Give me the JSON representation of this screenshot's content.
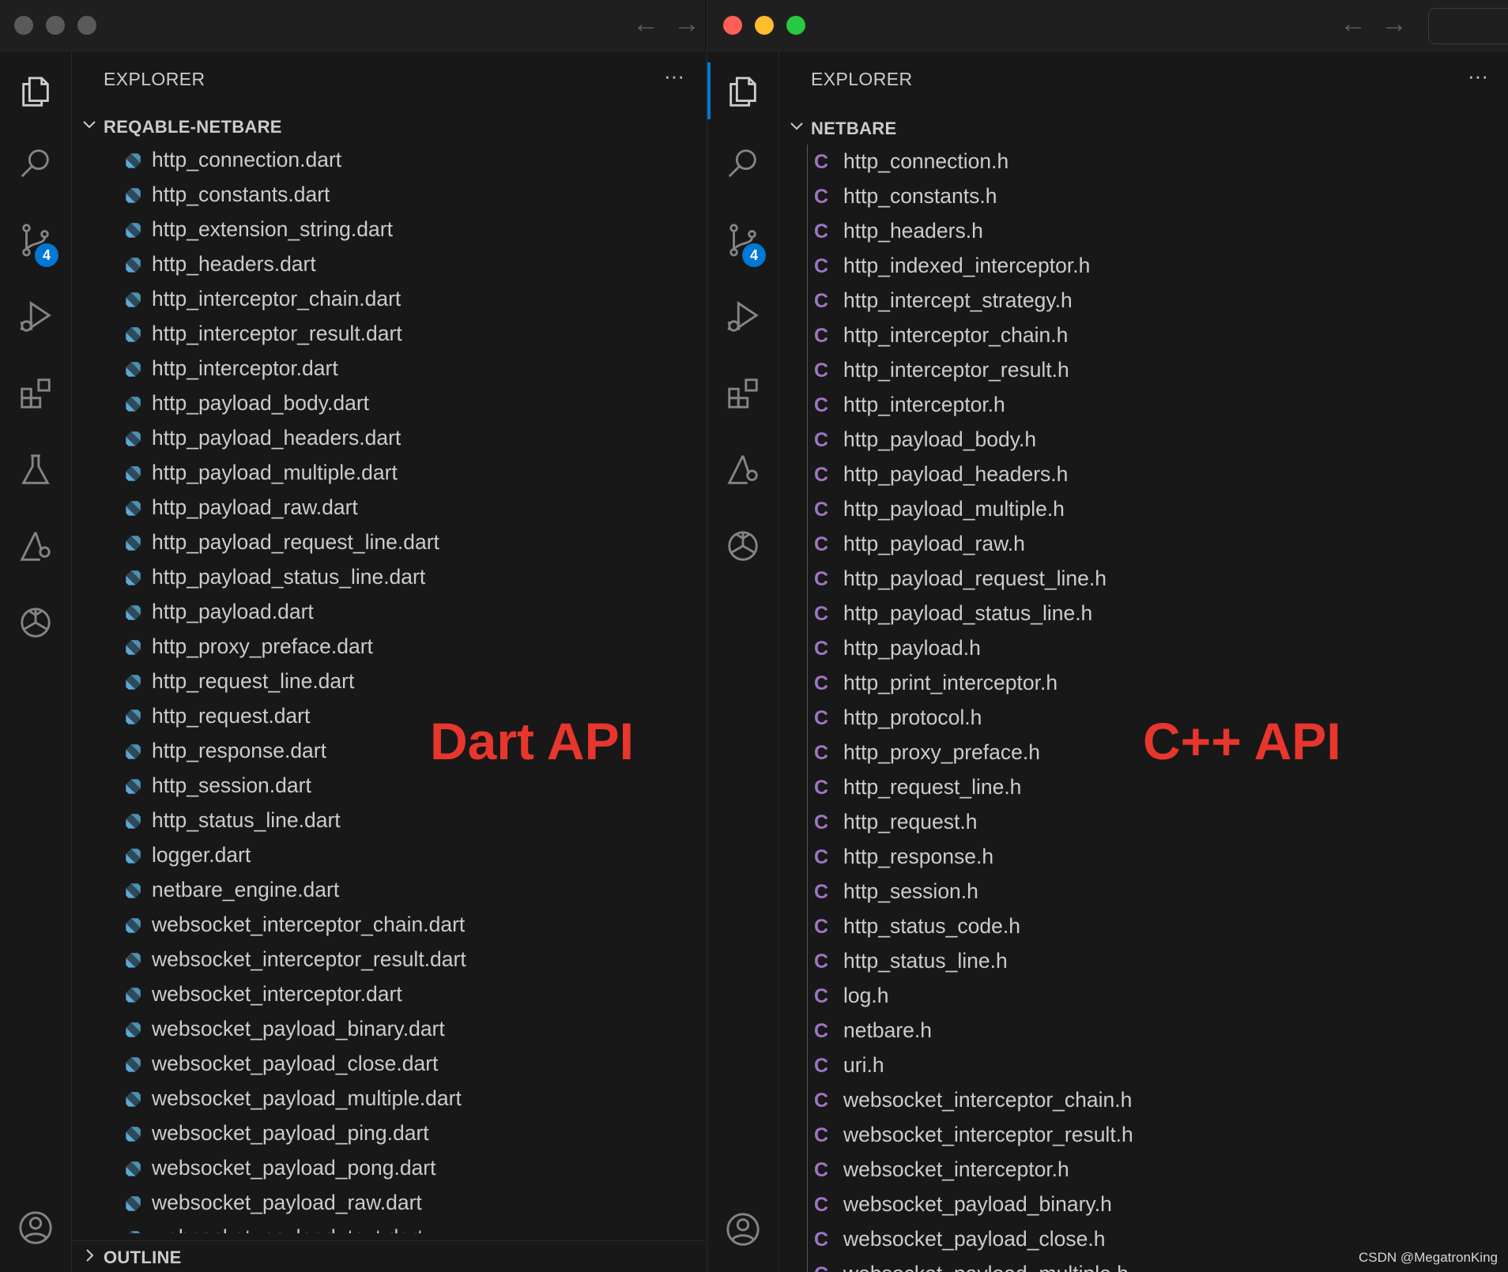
{
  "windows": [
    {
      "explorer_title": "EXPLORER",
      "folder_name": "REQABLE-NETBARE",
      "file_icon": "dart-icon",
      "icon_color": "#5aa9d6",
      "files": [
        "http_connection.dart",
        "http_constants.dart",
        "http_extension_string.dart",
        "http_headers.dart",
        "http_interceptor_chain.dart",
        "http_interceptor_result.dart",
        "http_interceptor.dart",
        "http_payload_body.dart",
        "http_payload_headers.dart",
        "http_payload_multiple.dart",
        "http_payload_raw.dart",
        "http_payload_request_line.dart",
        "http_payload_status_line.dart",
        "http_payload.dart",
        "http_proxy_preface.dart",
        "http_request_line.dart",
        "http_request.dart",
        "http_response.dart",
        "http_session.dart",
        "http_status_line.dart",
        "logger.dart",
        "netbare_engine.dart",
        "websocket_interceptor_chain.dart",
        "websocket_interceptor_result.dart",
        "websocket_interceptor.dart",
        "websocket_payload_binary.dart",
        "websocket_payload_close.dart",
        "websocket_payload_multiple.dart",
        "websocket_payload_ping.dart",
        "websocket_payload_pong.dart",
        "websocket_payload_raw.dart",
        "websocket_payload_text.dart"
      ],
      "outline_label": "OUTLINE",
      "annotation": "Dart API",
      "badge_count": "4",
      "traffic_lights": [
        "#5a5a5a",
        "#5a5a5a",
        "#5a5a5a"
      ]
    },
    {
      "explorer_title": "EXPLORER",
      "folder_name": "NETBARE",
      "file_icon": "c-header-icon",
      "icon_glyph": "C",
      "icon_color": "#a074c4",
      "files": [
        "http_connection.h",
        "http_constants.h",
        "http_headers.h",
        "http_indexed_interceptor.h",
        "http_intercept_strategy.h",
        "http_interceptor_chain.h",
        "http_interceptor_result.h",
        "http_interceptor.h",
        "http_payload_body.h",
        "http_payload_headers.h",
        "http_payload_multiple.h",
        "http_payload_raw.h",
        "http_payload_request_line.h",
        "http_payload_status_line.h",
        "http_payload.h",
        "http_print_interceptor.h",
        "http_protocol.h",
        "http_proxy_preface.h",
        "http_request_line.h",
        "http_request.h",
        "http_response.h",
        "http_session.h",
        "http_status_code.h",
        "http_status_line.h",
        "log.h",
        "netbare.h",
        "uri.h",
        "websocket_interceptor_chain.h",
        "websocket_interceptor_result.h",
        "websocket_interceptor.h",
        "websocket_payload_binary.h",
        "websocket_payload_close.h",
        "websocket_payload_multiple.h"
      ],
      "annotation": "C++ API",
      "badge_count": "4",
      "traffic_lights": [
        "#ff5f57",
        "#febc2e",
        "#28c840"
      ]
    }
  ],
  "nav_icons": [
    "arrow-left-icon",
    "arrow-right-icon"
  ],
  "activity_icons": [
    "files-icon",
    "search-icon",
    "source-control-icon",
    "run-debug-icon",
    "extensions-icon",
    "testing-icon",
    "copilot-icon",
    "chatgpt-icon",
    "account-icon"
  ],
  "annotation_color": "#e8362d",
  "watermark": "CSDN @MegatronKing"
}
